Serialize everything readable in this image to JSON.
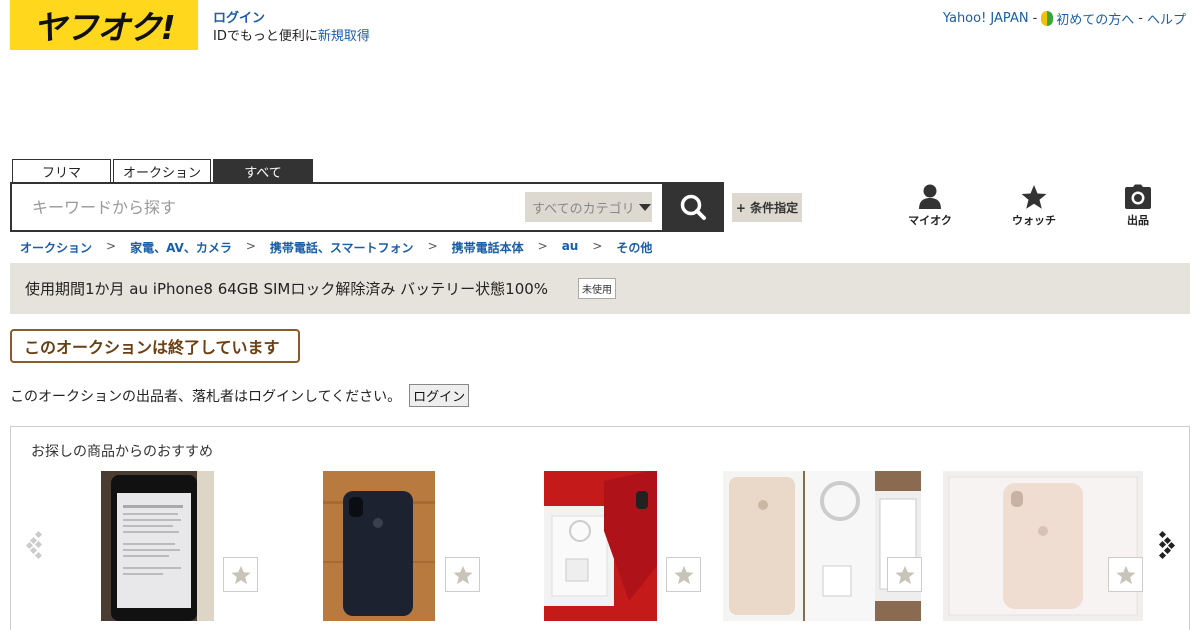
{
  "header": {
    "logo_text": "ヤフオク!",
    "login_link": "ログイン",
    "login_sub_prefix": "IDでもっと便利に",
    "signup_link": "新規取得",
    "yahoo_link": "Yahoo! JAPAN",
    "sep1": " -",
    "beginner_link": "初めての方へ",
    "sep2": " -",
    "help_link": "ヘルプ"
  },
  "search": {
    "tabs": [
      {
        "label": "フリマ",
        "active": false
      },
      {
        "label": "オークション",
        "active": false
      },
      {
        "label": "すべて",
        "active": true
      }
    ],
    "placeholder": "キーワードから探す",
    "category": "すべてのカテゴリ",
    "condition_label": "+ 条件指定",
    "icons": {
      "search": "search-icon",
      "caret": "caret-down-icon"
    }
  },
  "actions": [
    {
      "label": "マイオク",
      "icon": "user-icon"
    },
    {
      "label": "ウォッチ",
      "icon": "star-icon"
    },
    {
      "label": "出品",
      "icon": "camera-icon"
    }
  ],
  "breadcrumb": [
    "オークション",
    "家電、AV、カメラ",
    "携帯電話、スマートフォン",
    "携帯電話本体",
    "au",
    "その他"
  ],
  "breadcrumb_sep": ">",
  "item": {
    "title": "使用期間1か月 au iPhone8 64GB SIMロック解除済み バッテリー状態100%",
    "condition_badge": "未使用"
  },
  "status": {
    "ended_text": "このオークションは終了しています",
    "notice_text": "このオークションの出品者、落札者はログインしてください。",
    "login_button": "ログイン"
  },
  "recommend": {
    "heading": "お探しの商品からのおすすめ",
    "items": [
      {
        "image": "black iPhone showing settings screen",
        "watch_icon": "star-icon"
      },
      {
        "image": "black iPhone back on wooden table",
        "watch_icon": "star-icon"
      },
      {
        "image": "red iPhone in white box with cable",
        "watch_icon": "star-icon"
      },
      {
        "image": "gold iPhone with box and accessories",
        "watch_icon": "star-icon"
      },
      {
        "image": "gold iPhone back in white box",
        "watch_icon": "star-icon"
      }
    ],
    "prev_icon": "chevron-left-icon",
    "next_icon": "chevron-right-icon"
  },
  "colors": {
    "brand_yellow": "#ffd81e",
    "link_blue": "#1a5ea8",
    "title_bar": "#e5e3db",
    "ended_border": "#8b5a2b"
  }
}
